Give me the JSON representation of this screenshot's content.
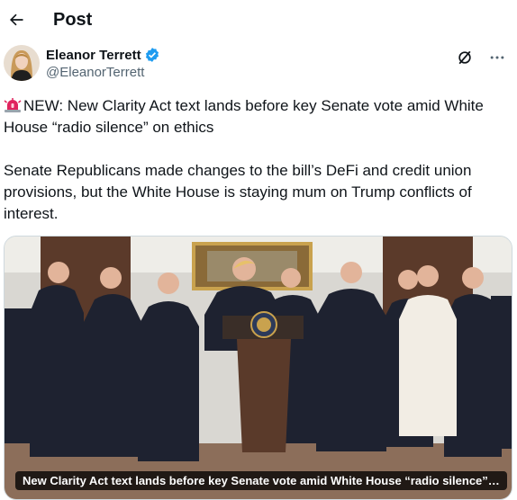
{
  "header": {
    "title": "Post"
  },
  "author": {
    "name": "Eleanor Terrett",
    "handle": "@EleanorTerrett",
    "verified": true
  },
  "post": {
    "paragraph_1": "NEW: New Clarity Act text lands before key Senate vote amid White House “radio silence” on ethics",
    "paragraph_2": "Senate Republicans made changes to the bill’s DeFi and credit union provisions, but the White House is staying mum on Trump conflicts of interest."
  },
  "card": {
    "caption": "New Clarity Act text lands before key Senate vote amid White House “radio silence” on..."
  },
  "icons": {
    "back": "arrow-left-icon",
    "verified": "verified-badge-icon",
    "grok": "grok-icon",
    "more": "more-icon",
    "siren": "siren-emoji-icon"
  },
  "colors": {
    "verified": "#1d9bf0",
    "handle": "#536471",
    "siren": "#e0245e"
  }
}
